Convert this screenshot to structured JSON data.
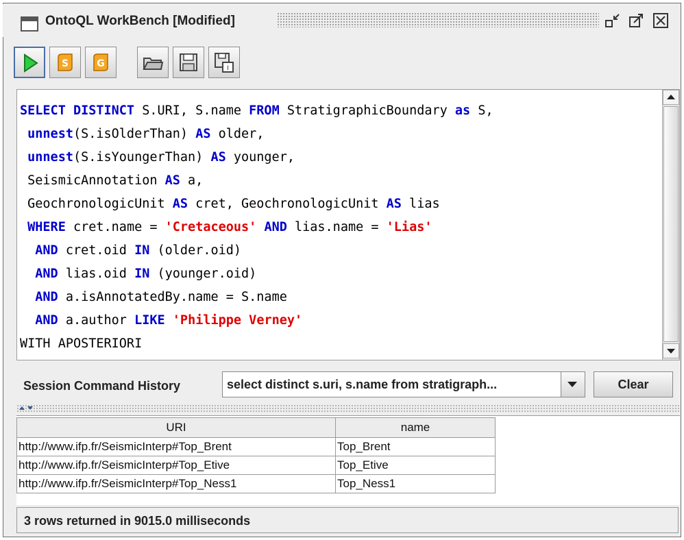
{
  "window": {
    "title": "OntoQL WorkBench [Modified]",
    "controls": [
      "minimize-icon",
      "maximize-icon",
      "close-icon"
    ]
  },
  "toolbar": {
    "buttons": [
      "run-icon",
      "script-s-icon",
      "script-g-icon",
      "open-folder-icon",
      "save-icon",
      "export-icon"
    ]
  },
  "editor": {
    "lines": [
      [
        {
          "t": "SELECT DISTINCT",
          "k": "kw"
        },
        {
          "t": " S.URI, S.name ",
          "k": ""
        },
        {
          "t": "FROM",
          "k": "kw"
        },
        {
          "t": " StratigraphicBoundary ",
          "k": ""
        },
        {
          "t": "as",
          "k": "kw"
        },
        {
          "t": " S,",
          "k": ""
        }
      ],
      [
        {
          "t": " ",
          "k": ""
        },
        {
          "t": "unnest",
          "k": "kw"
        },
        {
          "t": "(S.isOlderThan) ",
          "k": ""
        },
        {
          "t": "AS",
          "k": "kw"
        },
        {
          "t": " older,",
          "k": ""
        }
      ],
      [
        {
          "t": " ",
          "k": ""
        },
        {
          "t": "unnest",
          "k": "kw"
        },
        {
          "t": "(S.isYoungerThan) ",
          "k": ""
        },
        {
          "t": "AS",
          "k": "kw"
        },
        {
          "t": " younger,",
          "k": ""
        }
      ],
      [
        {
          "t": " SeismicAnnotation ",
          "k": ""
        },
        {
          "t": "AS",
          "k": "kw"
        },
        {
          "t": " a,",
          "k": ""
        }
      ],
      [
        {
          "t": " GeochronologicUnit ",
          "k": ""
        },
        {
          "t": "AS",
          "k": "kw"
        },
        {
          "t": " cret, GeochronologicUnit ",
          "k": ""
        },
        {
          "t": "AS",
          "k": "kw"
        },
        {
          "t": " lias",
          "k": ""
        }
      ],
      [
        {
          "t": " ",
          "k": ""
        },
        {
          "t": "WHERE",
          "k": "kw"
        },
        {
          "t": " cret.name = ",
          "k": ""
        },
        {
          "t": "'Cretaceous'",
          "k": "str"
        },
        {
          "t": " ",
          "k": ""
        },
        {
          "t": "AND",
          "k": "kw"
        },
        {
          "t": " lias.name = ",
          "k": ""
        },
        {
          "t": "'Lias'",
          "k": "str"
        }
      ],
      [
        {
          "t": "  ",
          "k": ""
        },
        {
          "t": "AND",
          "k": "kw"
        },
        {
          "t": " cret.oid ",
          "k": ""
        },
        {
          "t": "IN",
          "k": "kw"
        },
        {
          "t": " (older.oid)",
          "k": ""
        }
      ],
      [
        {
          "t": "  ",
          "k": ""
        },
        {
          "t": "AND",
          "k": "kw"
        },
        {
          "t": " lias.oid ",
          "k": ""
        },
        {
          "t": "IN",
          "k": "kw"
        },
        {
          "t": " (younger.oid)",
          "k": ""
        }
      ],
      [
        {
          "t": "  ",
          "k": ""
        },
        {
          "t": "AND",
          "k": "kw"
        },
        {
          "t": " a.isAnnotatedBy.name = S.name",
          "k": ""
        }
      ],
      [
        {
          "t": "  ",
          "k": ""
        },
        {
          "t": "AND",
          "k": "kw"
        },
        {
          "t": " a.author ",
          "k": ""
        },
        {
          "t": "LIKE",
          "k": "kw"
        },
        {
          "t": " ",
          "k": ""
        },
        {
          "t": "'Philippe Verney'",
          "k": "str"
        }
      ],
      [
        {
          "t": "WITH APOSTERIORI",
          "k": ""
        }
      ]
    ]
  },
  "history": {
    "label": "Session Command History",
    "selected": "select distinct s.uri, s.name from stratigraph...",
    "clear_label": "Clear"
  },
  "results": {
    "columns": [
      "URI",
      "name"
    ],
    "rows": [
      [
        "http://www.ifp.fr/SeismicInterp#Top_Brent",
        "Top_Brent"
      ],
      [
        "http://www.ifp.fr/SeismicInterp#Top_Etive",
        "Top_Etive"
      ],
      [
        "http://www.ifp.fr/SeismicInterp#Top_Ness1",
        "Top_Ness1"
      ]
    ]
  },
  "status": {
    "text": "3 rows returned in 9015.0 milliseconds"
  },
  "colors": {
    "keyword": "#0000cc",
    "string": "#e00000",
    "background": "#eeeeee"
  }
}
